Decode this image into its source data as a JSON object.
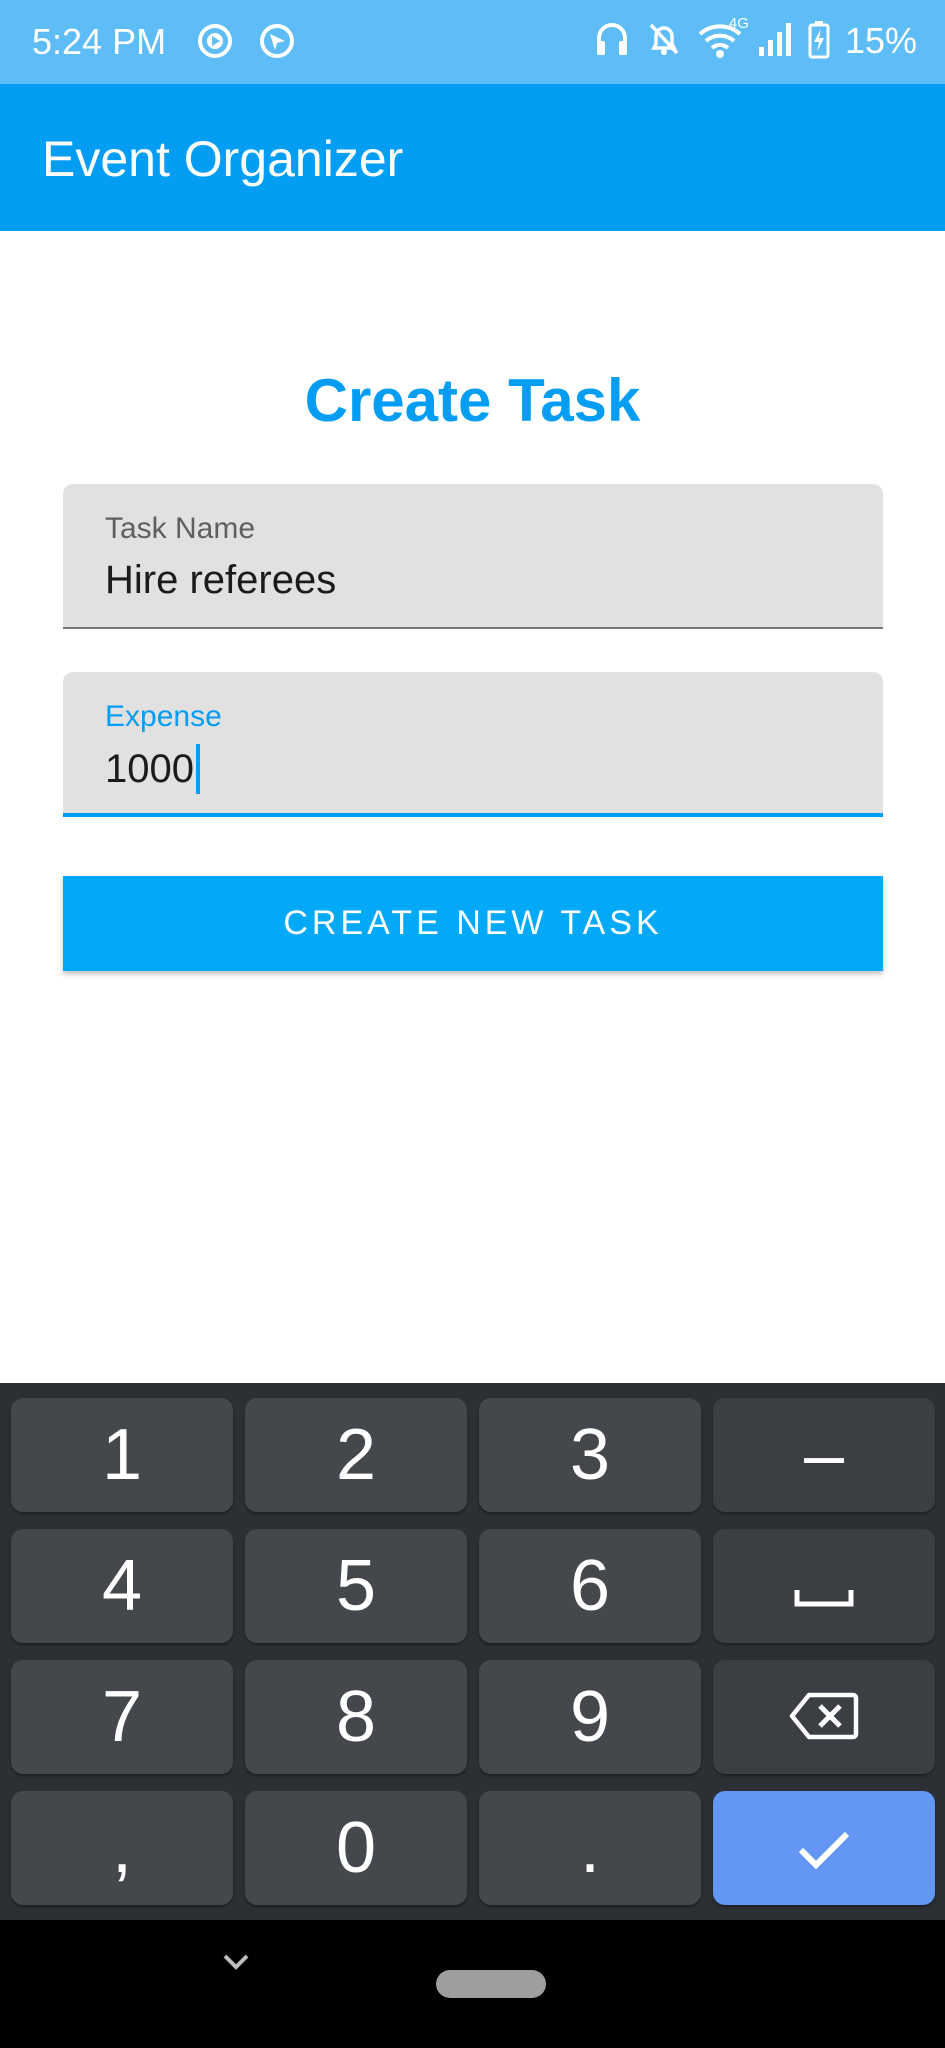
{
  "status_bar": {
    "time": "5:24 PM",
    "network_label": "4G",
    "battery": "15%"
  },
  "app_bar": {
    "title": "Event Organizer"
  },
  "form": {
    "heading": "Create Task",
    "task_name": {
      "label": "Task Name",
      "value": "Hire referees"
    },
    "expense": {
      "label": "Expense",
      "value": "1000"
    },
    "submit_label": "CREATE NEW TASK"
  },
  "keyboard": {
    "keys": [
      "1",
      "2",
      "3",
      "–",
      "4",
      "5",
      "6",
      "7",
      "8",
      "9",
      ",",
      "0",
      "."
    ],
    "icons": [
      "space-icon",
      "backspace-icon",
      "check-icon"
    ]
  },
  "colors": {
    "status_bar": "#5ebcf6",
    "app_bar": "#039df4",
    "accent": "#039df4",
    "button": "#03a9f9",
    "keyboard_bg": "#2c3034",
    "key_bg": "#44474b",
    "enter_key": "#6497f5"
  }
}
